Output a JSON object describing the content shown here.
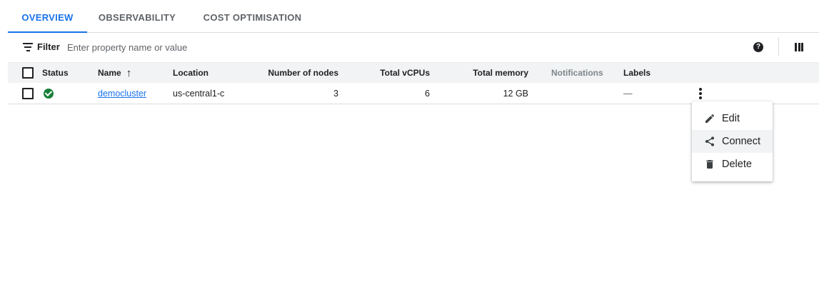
{
  "tabs": [
    {
      "label": "OVERVIEW",
      "active": true
    },
    {
      "label": "OBSERVABILITY",
      "active": false
    },
    {
      "label": "COST OPTIMISATION",
      "active": false
    }
  ],
  "filter": {
    "label": "Filter",
    "placeholder": "Enter property name or value",
    "help_icon": "help-circle-icon",
    "columns_icon": "column-display-icon"
  },
  "table": {
    "columns": [
      "Status",
      "Name",
      "Location",
      "Number of nodes",
      "Total vCPUs",
      "Total memory",
      "Notifications",
      "Labels"
    ],
    "sort": {
      "column": "Name",
      "direction": "ascending"
    },
    "rows": [
      {
        "status": "running",
        "name": "democluster",
        "location": "us-central1-c",
        "nodes": "3",
        "vcpus": "6",
        "memory": "12 GB",
        "notifications": "",
        "labels": "—"
      }
    ]
  },
  "context_menu": {
    "items": [
      {
        "label": "Edit",
        "icon": "pencil-icon"
      },
      {
        "label": "Connect",
        "icon": "share-connect-icon"
      },
      {
        "label": "Delete",
        "icon": "trash-icon"
      }
    ]
  },
  "colors": {
    "accent": "#1a73e8",
    "status_ok": "#188038",
    "header_bg": "#f1f3f4"
  }
}
